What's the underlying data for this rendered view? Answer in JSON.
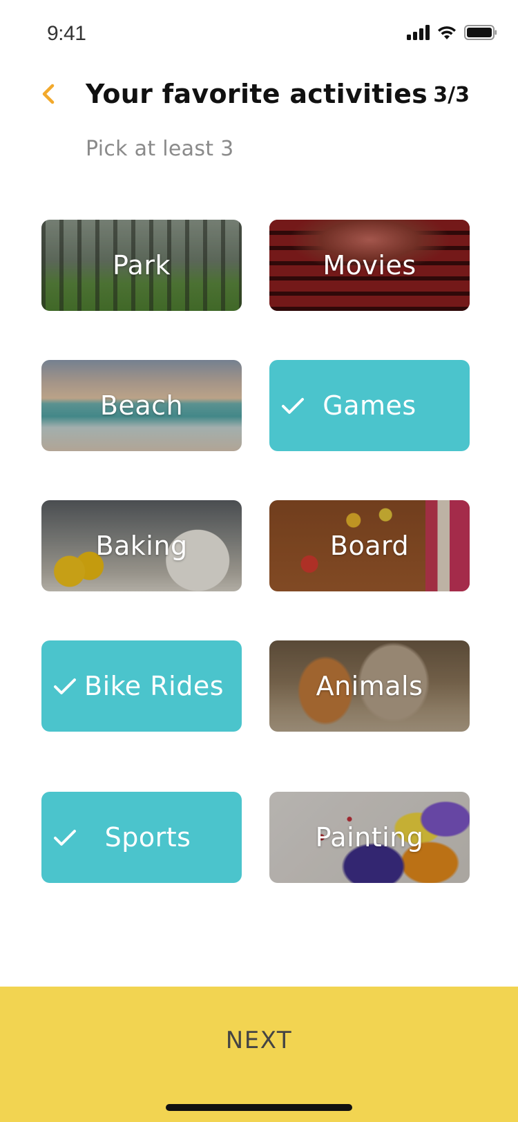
{
  "status_bar": {
    "time": "9:41",
    "icons": [
      "signal-icon",
      "wifi-icon",
      "battery-icon"
    ]
  },
  "header": {
    "back_icon": "chevron-left-icon",
    "title": "Your favorite activities",
    "step": "3/3",
    "subtitle": "Pick at least 3"
  },
  "colors": {
    "accent": "#f2a92c",
    "selected_tile": "#4bc4cc",
    "next_bar": "#f2d451"
  },
  "activities": [
    {
      "label": "Park",
      "selected": false
    },
    {
      "label": "Movies",
      "selected": false
    },
    {
      "label": "Beach",
      "selected": false
    },
    {
      "label": "Games",
      "selected": true
    },
    {
      "label": "Baking",
      "selected": false
    },
    {
      "label": "Board",
      "selected": false
    },
    {
      "label": "Bike Rides",
      "selected": true
    },
    {
      "label": "Animals",
      "selected": false
    },
    {
      "label": "Sports",
      "selected": true
    },
    {
      "label": "Painting",
      "selected": false
    }
  ],
  "footer": {
    "next_label": "NEXT"
  }
}
